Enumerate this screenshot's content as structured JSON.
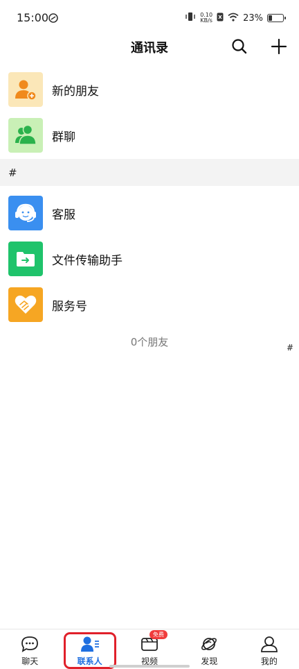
{
  "status_bar": {
    "time": "15:00",
    "net_speed_value": "0.10",
    "net_speed_unit": "KB/s",
    "battery_percent": "23%",
    "battery_level": 0.23
  },
  "header": {
    "title": "通讯录"
  },
  "list": {
    "top_items": [
      {
        "label": "新的朋友",
        "icon": "add-friend-icon",
        "color": "#fbe7b8"
      },
      {
        "label": "群聊",
        "icon": "group-chat-icon",
        "color": "#c9f0b6"
      }
    ],
    "section_letter": "#",
    "contacts": [
      {
        "label": "客服",
        "icon": "customer-service-icon",
        "color": "#3a8ff0"
      },
      {
        "label": "文件传输助手",
        "icon": "file-transfer-icon",
        "color": "#1fc36b"
      },
      {
        "label": "服务号",
        "icon": "service-account-icon",
        "color": "#f6a623"
      }
    ],
    "friend_count": "0个朋友",
    "index_letter": "#"
  },
  "bottom_nav": {
    "items": [
      {
        "label": "聊天",
        "icon": "chat-icon"
      },
      {
        "label": "联系人",
        "icon": "contacts-icon",
        "active": true
      },
      {
        "label": "视频",
        "icon": "video-icon",
        "badge": "免费"
      },
      {
        "label": "发现",
        "icon": "discover-planet-icon"
      },
      {
        "label": "我的",
        "icon": "profile-icon"
      }
    ]
  }
}
